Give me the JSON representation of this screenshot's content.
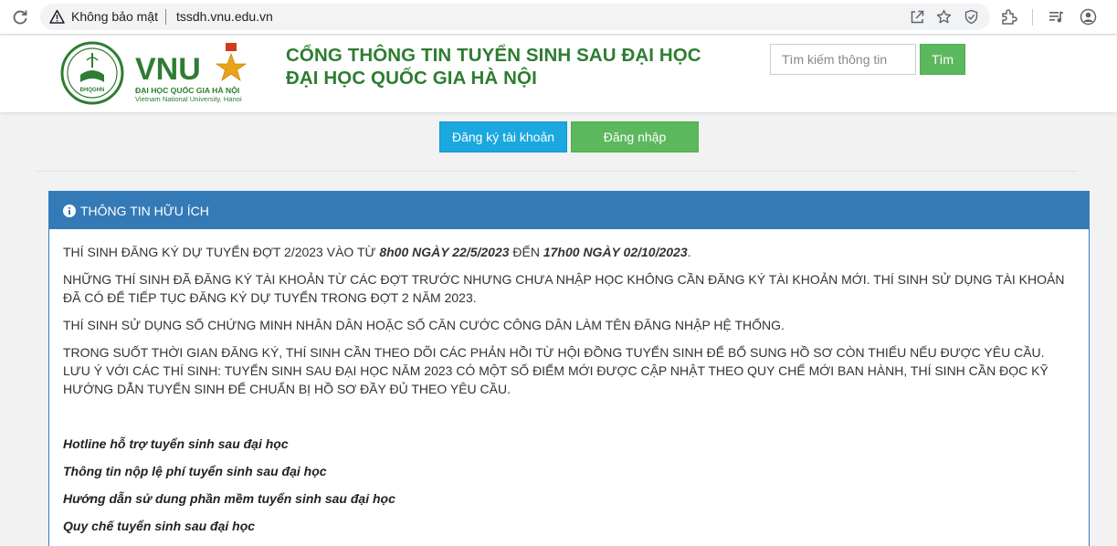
{
  "browser": {
    "security_label": "Không bảo mật",
    "url": "tssdh.vnu.edu.vn"
  },
  "header": {
    "logo": {
      "badge_text": "ĐHQGHN",
      "wordmark": "VNU",
      "name_vi": "ĐẠI HỌC QUỐC GIA HÀ NỘI",
      "name_en": "Vietnam National University, Hanoi"
    },
    "title_line1": "CỔNG THÔNG TIN TUYỂN SINH SAU ĐẠI HỌC",
    "title_line2": "ĐẠI HỌC QUỐC GIA HÀ NỘI",
    "search_placeholder": "Tìm kiếm thông tin",
    "search_button": "Tìm"
  },
  "auth": {
    "register_label": "Đăng ký tài khoản",
    "login_label": "Đăng nhập"
  },
  "panel": {
    "heading": "THÔNG TIN HỮU ÍCH",
    "p1_before": "THÍ SINH ĐĂNG KÝ DỰ TUYỂN ĐỢT 2/2023 VÀO TỪ ",
    "p1_start": "8h00 NGÀY 22/5/2023",
    "p1_mid": " ĐẾN ",
    "p1_end": "17h00 NGÀY 02/10/2023",
    "p1_after": ".",
    "p2": "NHỮNG THÍ SINH ĐÃ ĐĂNG KÝ TÀI KHOẢN TỪ CÁC ĐỢT TRƯỚC NHƯNG CHƯA NHẬP HỌC KHÔNG CẦN ĐĂNG KÝ TÀI KHOẢN MỚI. THÍ SINH SỬ DỤNG TÀI KHOẢN ĐÃ CÓ ĐỂ TIẾP TỤC ĐĂNG KÝ DỰ TUYỂN TRONG ĐỢT 2 NĂM 2023.",
    "p3": "THÍ SINH SỬ DỤNG SỐ CHỨNG MINH NHÂN DÂN HOẶC SỐ CĂN CƯỚC CÔNG DÂN LÀM TÊN ĐĂNG NHẬP HỆ THỐNG.",
    "p4": "TRONG SUỐT THỜI GIAN ĐĂNG KÝ, THÍ SINH CẦN THEO DÕI CÁC PHẢN HỒI TỪ HỘI ĐỒNG TUYỂN SINH ĐỂ BỔ SUNG HỒ SƠ CÒN THIẾU NẾU ĐƯỢC YÊU CẦU. LƯU Ý VỚI CÁC THÍ SINH: TUYỂN SINH SAU ĐẠI HỌC NĂM 2023 CÓ MỘT SỐ ĐIỂM MỚI ĐƯỢC CẬP NHẬT THEO QUY CHẾ MỚI BAN HÀNH, THÍ SINH CẦN ĐỌC KỸ HƯỚNG DẪN TUYỂN SINH ĐỂ CHUẨN BỊ HỒ SƠ ĐẦY ĐỦ THEO YÊU CẦU.",
    "links": [
      "Hotline hỗ trợ tuyển sinh sau đại học",
      "Thông tin nộp lệ phí tuyển sinh sau đại học",
      "Hướng dẫn sử dung phần mềm tuyển sinh sau đại học",
      "Quy chế tuyển sinh sau đại học"
    ]
  },
  "colors": {
    "title_green": "#2e7d32",
    "button_green": "#5cb85c",
    "button_blue": "#1ba7e0",
    "panel_blue": "#337ab7"
  },
  "icons": {
    "reload": "reload-icon",
    "warning": "warning-icon",
    "share": "share-icon",
    "bookmark": "star-icon",
    "shield": "shield-icon",
    "extensions": "puzzle-icon",
    "media": "media-icon",
    "profile": "profile-icon",
    "info": "info-icon"
  }
}
